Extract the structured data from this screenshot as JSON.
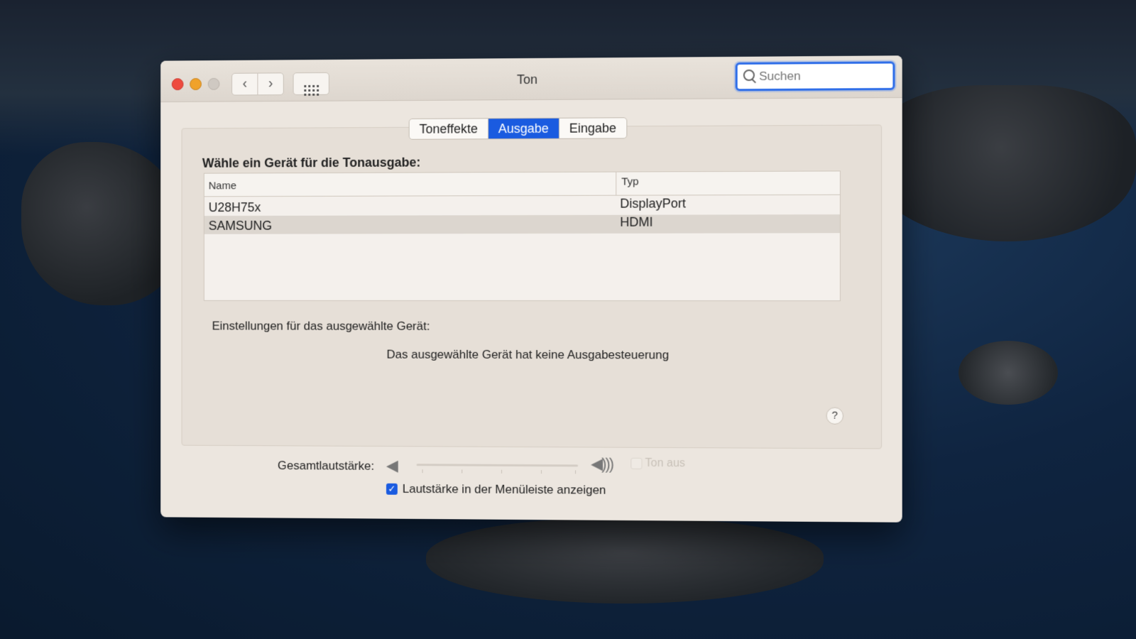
{
  "window": {
    "title": "Ton",
    "search_placeholder": "Suchen"
  },
  "tabs": [
    {
      "label": "Toneffekte",
      "active": false
    },
    {
      "label": "Ausgabe",
      "active": true
    },
    {
      "label": "Eingabe",
      "active": false
    }
  ],
  "output": {
    "prompt": "Wähle ein Gerät für die Tonausgabe:",
    "columns": {
      "name": "Name",
      "type": "Typ"
    },
    "devices": [
      {
        "name": "U28H75x",
        "type": "DisplayPort",
        "selected": false
      },
      {
        "name": "SAMSUNG",
        "type": "HDMI",
        "selected": true
      }
    ]
  },
  "settings": {
    "label": "Einstellungen für das ausgewählte Gerät:",
    "message": "Das ausgewählte Gerät hat keine Ausgabesteuerung"
  },
  "volume": {
    "label": "Gesamtlautstärke:",
    "mute_label": "Ton aus",
    "mute_checked": false,
    "show_in_menubar_label": "Lautstärke in der Menüleiste anzeigen",
    "show_in_menubar_checked": true,
    "enabled": false
  },
  "help": {
    "label": "?"
  },
  "colors": {
    "accent": "#1a5be0",
    "close": "#ee4b3f",
    "minimize": "#f0a22a"
  }
}
